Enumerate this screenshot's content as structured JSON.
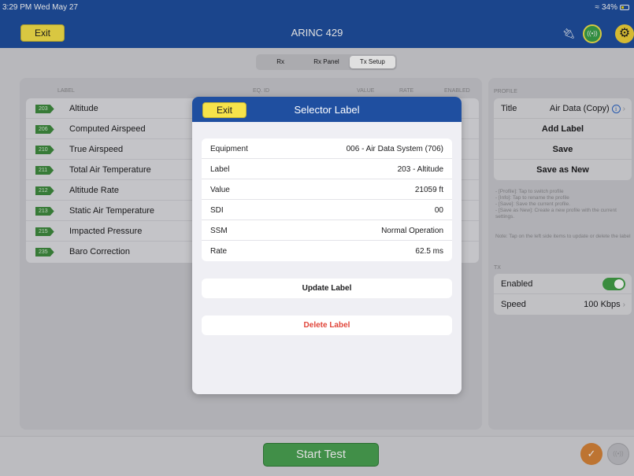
{
  "status": {
    "time": "3:29 PM  Wed May 27",
    "battery": "34%"
  },
  "header": {
    "exit_label": "Exit",
    "title": "ARINC 429",
    "icons": [
      "plug-icon",
      "signal-icon",
      "gear-icon"
    ]
  },
  "tabs": [
    {
      "label": "Rx",
      "active": false
    },
    {
      "label": "Rx Panel",
      "active": false
    },
    {
      "label": "Tx Setup",
      "active": true
    }
  ],
  "table": {
    "headers": {
      "label": "LABEL",
      "eqid": "EQ. ID",
      "value": "VALUE",
      "rate": "RATE",
      "enabled": "ENABLED"
    },
    "rows": [
      {
        "code": "203",
        "name": "Altitude"
      },
      {
        "code": "206",
        "name": "Computed Airspeed"
      },
      {
        "code": "210",
        "name": "True Airspeed"
      },
      {
        "code": "211",
        "name": "Total Air Temperature"
      },
      {
        "code": "212",
        "name": "Altitude Rate"
      },
      {
        "code": "213",
        "name": "Static Air Temperature"
      },
      {
        "code": "215",
        "name": "Impacted Pressure"
      },
      {
        "code": "235",
        "name": "Baro Correction"
      }
    ]
  },
  "profile": {
    "caption": "PROFILE",
    "title_key": "Title",
    "title_value": "Air Data (Copy)",
    "add_label": "Add Label",
    "save": "Save",
    "save_as_new": "Save as New",
    "help": "- [Profile]: Tap to switch profile\n- [Info]: Tap to rename the profile\n- [Save]: Save the current profile.\n- [Save as New]: Create a new profile with the current settings.",
    "note": "Note: Tap on the left side items to update or delete the label"
  },
  "tx": {
    "caption": "TX",
    "enabled_key": "Enabled",
    "enabled": true,
    "speed_key": "Speed",
    "speed_value": "100 Kbps"
  },
  "modal": {
    "exit_label": "Exit",
    "title": "Selector Label",
    "details": [
      {
        "key": "Equipment",
        "value": "006 - Air Data System (706)"
      },
      {
        "key": "Label",
        "value": "203 - Altitude"
      },
      {
        "key": "Value",
        "value": "21059 ft"
      },
      {
        "key": "SDI",
        "value": "00"
      },
      {
        "key": "SSM",
        "value": "Normal Operation"
      },
      {
        "key": "Rate",
        "value": "62.5 ms"
      }
    ],
    "update_label": "Update Label",
    "delete_label": "Delete Label"
  },
  "footer": {
    "start_test": "Start Test"
  },
  "colors": {
    "nav_blue": "#1f4fa0",
    "exit_yellow": "#f7e34a",
    "start_green": "#4ba352",
    "tag_green": "#3f8b3f",
    "danger_red": "#e0453a"
  }
}
